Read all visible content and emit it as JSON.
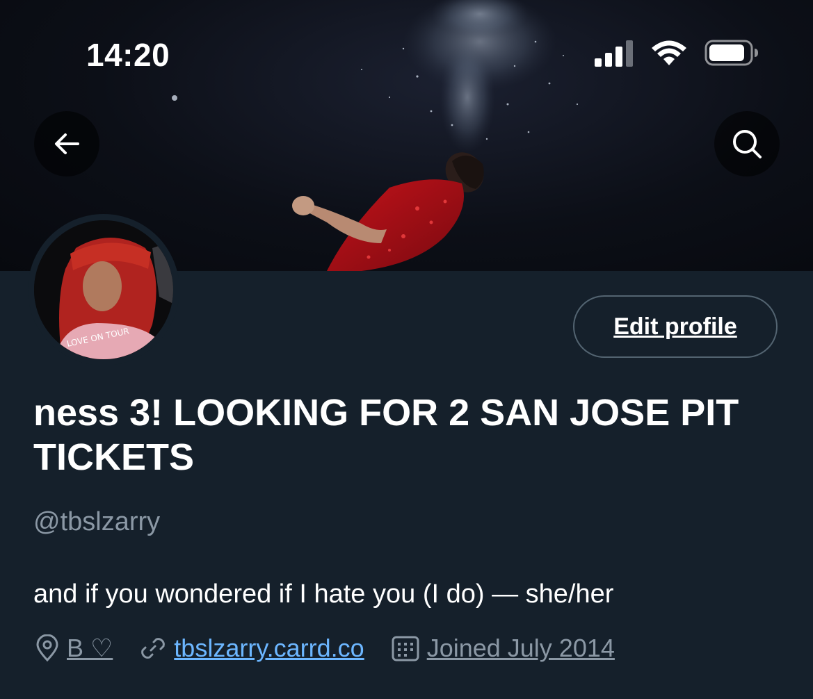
{
  "status_bar": {
    "time": "14:20"
  },
  "header": {
    "back_icon": "arrow-left-icon",
    "search_icon": "search-icon"
  },
  "profile": {
    "edit_button_label": "Edit profile",
    "display_name": "ness 3! LOOKING FOR 2 SAN JOSE PIT TICKETS",
    "handle": "@tbslzarry",
    "bio": "and if you wondered if I hate you (I do) — she/her",
    "location": "B ♡",
    "website": "tbslzarry.carrd.co",
    "joined": "Joined July 2014"
  },
  "avatar": {
    "shirt_text": "LOVE ON TOUR"
  },
  "colors": {
    "background": "#15202b",
    "muted_text": "#8b98a5",
    "link": "#6cb6ff",
    "button_border": "#536471"
  }
}
